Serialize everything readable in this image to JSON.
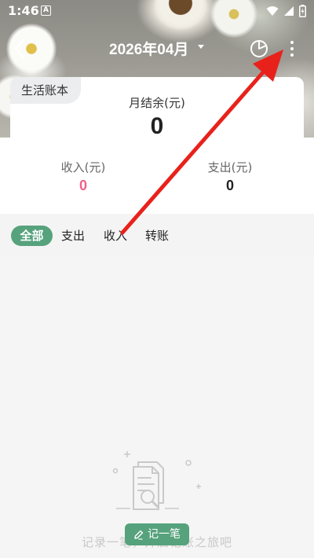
{
  "status_bar": {
    "time": "1:46",
    "notification_badge": "A",
    "icons": [
      "wifi-icon",
      "signal-icon",
      "battery-icon"
    ]
  },
  "nav": {
    "month": "2026年04月",
    "back_icon": "chevron-left-icon",
    "chart_icon": "pie-chart-icon",
    "more_icon": "more-vertical-icon"
  },
  "summary": {
    "book_name": "生活账本",
    "balance_label": "月结余(元)",
    "balance_value": "0",
    "income_label": "收入(元)",
    "income_value": "0",
    "expense_label": "支出(元)",
    "expense_value": "0"
  },
  "filters": {
    "tabs": [
      {
        "label": "全部",
        "active": true
      },
      {
        "label": "支出",
        "active": false
      },
      {
        "label": "收入",
        "active": false
      },
      {
        "label": "转账",
        "active": false
      }
    ]
  },
  "empty_state": {
    "message": "记录一笔，开启记账之旅吧",
    "record_button": "记一笔",
    "illustration_icon": "document-search-icon"
  },
  "colors": {
    "accent": "#56a27d",
    "income": "#f0608a",
    "annotation_arrow": "#e8221b"
  }
}
